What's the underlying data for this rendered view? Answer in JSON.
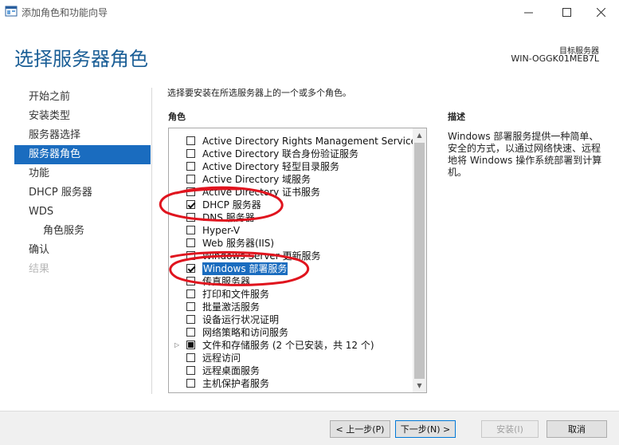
{
  "window": {
    "title": "添加角色和功能向导"
  },
  "header": {
    "title": "选择服务器角色",
    "target_label": "目标服务器",
    "target_server": "WIN-OGGK01MEB7L"
  },
  "nav": [
    {
      "label": "开始之前",
      "state": "normal"
    },
    {
      "label": "安装类型",
      "state": "normal"
    },
    {
      "label": "服务器选择",
      "state": "normal"
    },
    {
      "label": "服务器角色",
      "state": "active"
    },
    {
      "label": "功能",
      "state": "normal"
    },
    {
      "label": "DHCP 服务器",
      "state": "normal"
    },
    {
      "label": "WDS",
      "state": "normal"
    },
    {
      "label": "角色服务",
      "state": "sub"
    },
    {
      "label": "确认",
      "state": "normal"
    },
    {
      "label": "结果",
      "state": "disabled"
    }
  ],
  "content": {
    "instruction": "选择要安装在所选服务器上的一个或多个角色。",
    "roles_header": "角色",
    "description_header": "描述",
    "description_text": "Windows 部署服务提供一种简单、安全的方式，以通过网络快速、远程地将 Windows 操作系统部署到计算机。"
  },
  "roles": [
    {
      "label": "Active Directory Rights Management Services",
      "state": "unchecked"
    },
    {
      "label": "Active Directory 联合身份验证服务",
      "state": "unchecked"
    },
    {
      "label": "Active Directory 轻型目录服务",
      "state": "unchecked"
    },
    {
      "label": "Active Directory 域服务",
      "state": "unchecked"
    },
    {
      "label": "Active Directory 证书服务",
      "state": "unchecked"
    },
    {
      "label": "DHCP 服务器",
      "state": "checked"
    },
    {
      "label": "DNS 服务器",
      "state": "unchecked"
    },
    {
      "label": "Hyper-V",
      "state": "unchecked"
    },
    {
      "label": "Web 服务器(IIS)",
      "state": "unchecked"
    },
    {
      "label": "Windows Server 更新服务",
      "state": "unchecked"
    },
    {
      "label": "Windows 部署服务",
      "state": "checked",
      "selected": true
    },
    {
      "label": "传真服务器",
      "state": "unchecked"
    },
    {
      "label": "打印和文件服务",
      "state": "unchecked"
    },
    {
      "label": "批量激活服务",
      "state": "unchecked"
    },
    {
      "label": "设备运行状况证明",
      "state": "unchecked"
    },
    {
      "label": "网络策略和访问服务",
      "state": "unchecked"
    },
    {
      "label": "文件和存储服务 (2 个已安装，共 12 个)",
      "state": "partial",
      "expandable": true
    },
    {
      "label": "远程访问",
      "state": "unchecked"
    },
    {
      "label": "远程桌面服务",
      "state": "unchecked"
    },
    {
      "label": "主机保护者服务",
      "state": "unchecked"
    }
  ],
  "buttons": {
    "prev": "< 上一步(P)",
    "next": "下一步(N) >",
    "install": "安装(I)",
    "cancel": "取消"
  },
  "colors": {
    "accent": "#1a6cbf",
    "title": "#1a5e96",
    "annotation": "#e0141e"
  }
}
